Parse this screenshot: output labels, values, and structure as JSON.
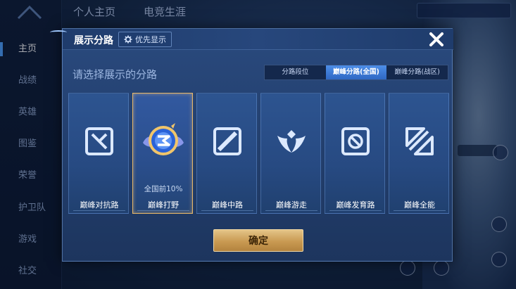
{
  "background": {
    "nav_items": [
      "主页",
      "战绩",
      "英雄",
      "图鉴",
      "荣誉",
      "护卫队",
      "游戏",
      "社交"
    ],
    "tabs": [
      "个人主页",
      "电竞生涯"
    ]
  },
  "dialog": {
    "title": "展示分路",
    "priority_label": "优先显示",
    "subtitle": "请选择展示的分路",
    "segments": [
      {
        "label": "分路段位",
        "active": false
      },
      {
        "label": "巅峰分路(全国)",
        "active": true
      },
      {
        "label": "巅峰分路(战区)",
        "active": false
      }
    ],
    "cards": [
      {
        "label": "巅峰对抗路",
        "icon": "lane-clash-icon",
        "selected": false,
        "rank": ""
      },
      {
        "label": "巅峰打野",
        "icon": "jungle-emblem-icon",
        "selected": true,
        "rank": "全国前10%"
      },
      {
        "label": "巅峰中路",
        "icon": "lane-mid-icon",
        "selected": false,
        "rank": ""
      },
      {
        "label": "巅峰游走",
        "icon": "lane-roam-icon",
        "selected": false,
        "rank": ""
      },
      {
        "label": "巅峰发育路",
        "icon": "lane-farm-icon",
        "selected": false,
        "rank": ""
      },
      {
        "label": "巅峰全能",
        "icon": "all-lanes-icon",
        "selected": false,
        "rank": ""
      }
    ],
    "confirm_label": "确定"
  },
  "colors": {
    "accent": "#4d8ee8",
    "confirm": "#c99a52",
    "selected_border": "#e8b868"
  }
}
